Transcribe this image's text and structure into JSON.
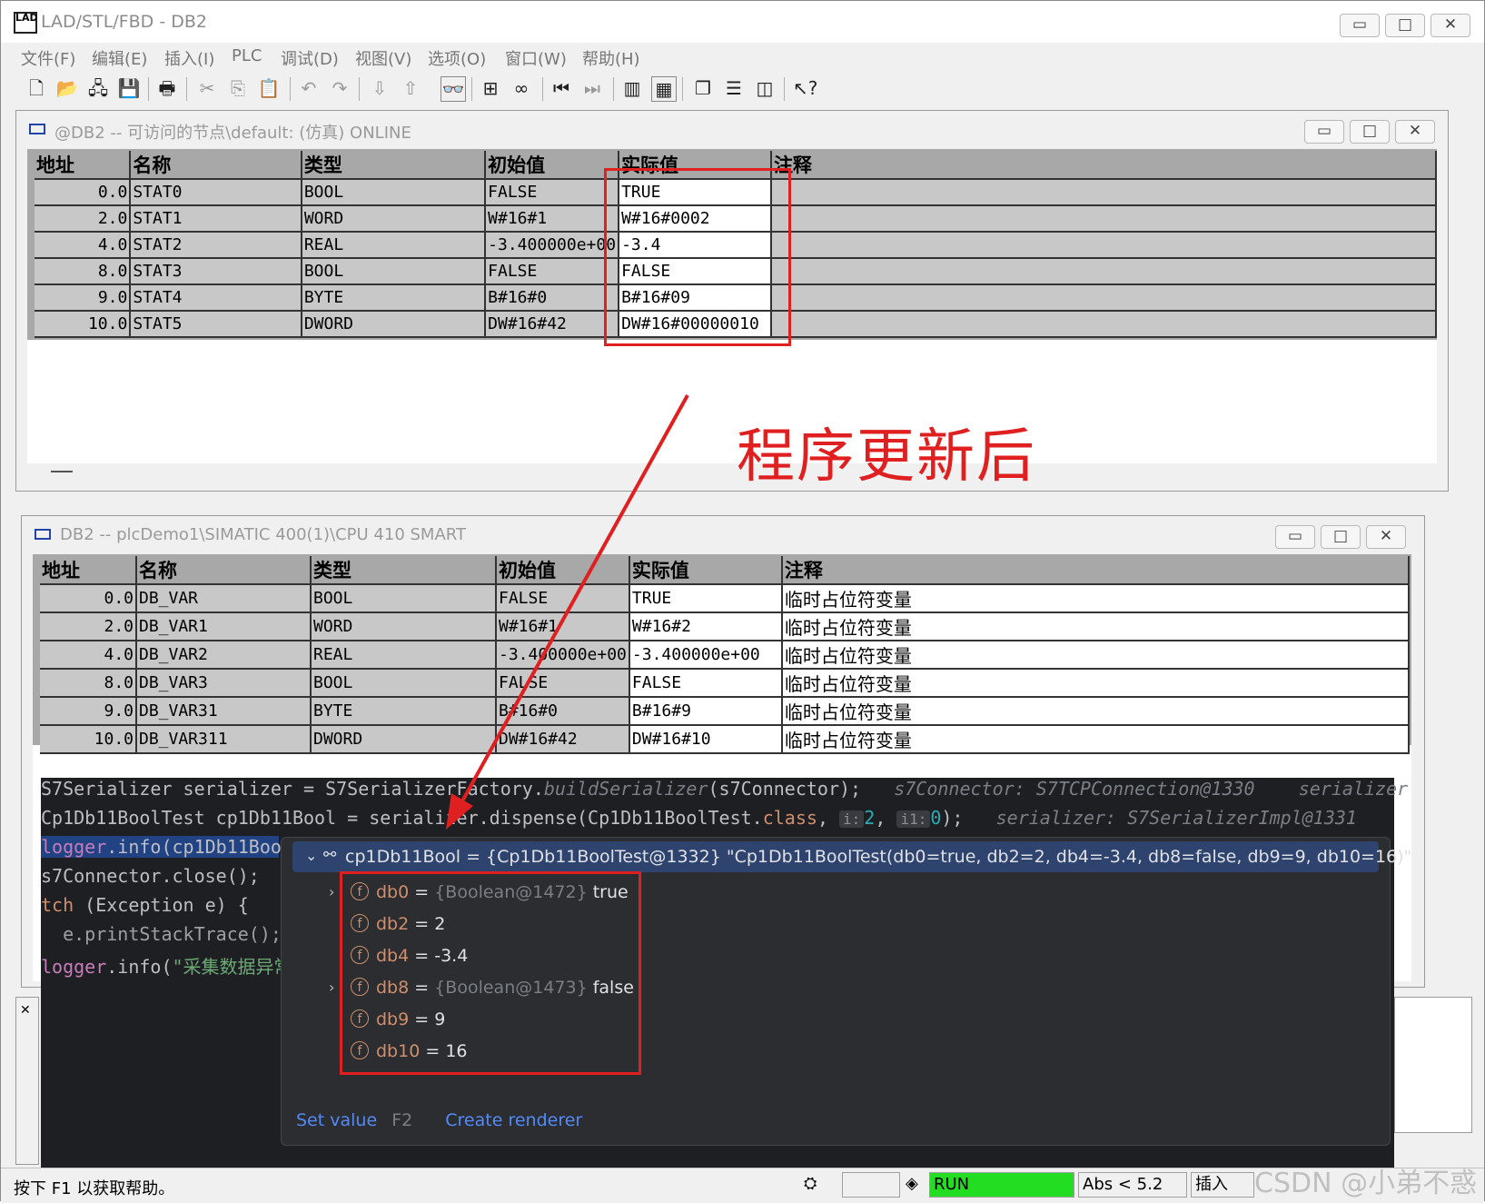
{
  "window": {
    "title": "LAD/STL/FBD  - DB2",
    "app_icon_text": "LAD"
  },
  "menu": [
    "文件(F)",
    "编辑(E)",
    "插入(I)",
    "PLC",
    "调试(D)",
    "视图(V)",
    "选项(O)",
    "窗口(W)",
    "帮助(H)"
  ],
  "online_window": {
    "title": "@DB2 -- 可访问的节点\\default:  (仿真)  ONLINE",
    "columns": [
      "地址",
      "名称",
      "类型",
      "初始值",
      "实际值",
      "注释"
    ],
    "rows": [
      {
        "addr": "0.0",
        "name": "STAT0",
        "type": "BOOL",
        "init": "FALSE",
        "actual": "TRUE",
        "comment": ""
      },
      {
        "addr": "2.0",
        "name": "STAT1",
        "type": "WORD",
        "init": "W#16#1",
        "actual": "W#16#0002",
        "comment": ""
      },
      {
        "addr": "4.0",
        "name": "STAT2",
        "type": "REAL",
        "init": "-3.400000e+00",
        "actual": "-3.4",
        "comment": ""
      },
      {
        "addr": "8.0",
        "name": "STAT3",
        "type": "BOOL",
        "init": "FALSE",
        "actual": "FALSE",
        "comment": ""
      },
      {
        "addr": "9.0",
        "name": "STAT4",
        "type": "BYTE",
        "init": "B#16#0",
        "actual": "B#16#09",
        "comment": ""
      },
      {
        "addr": "10.0",
        "name": "STAT5",
        "type": "DWORD",
        "init": "DW#16#42",
        "actual": "DW#16#00000010",
        "comment": ""
      }
    ]
  },
  "offline_window": {
    "title": "DB2 -- plcDemo1\\SIMATIC 400(1)\\CPU 410 SMART",
    "columns": [
      "地址",
      "名称",
      "类型",
      "初始值",
      "实际值",
      "注释"
    ],
    "rows": [
      {
        "addr": "0.0",
        "name": "DB_VAR",
        "type": "BOOL",
        "init": "FALSE",
        "actual": "TRUE",
        "comment": "临时占位符变量"
      },
      {
        "addr": "2.0",
        "name": "DB_VAR1",
        "type": "WORD",
        "init": "W#16#1",
        "actual": "W#16#2",
        "comment": "临时占位符变量"
      },
      {
        "addr": "4.0",
        "name": "DB_VAR2",
        "type": "REAL",
        "init": "-3.400000e+00",
        "actual": "-3.400000e+00",
        "comment": "临时占位符变量"
      },
      {
        "addr": "8.0",
        "name": "DB_VAR3",
        "type": "BOOL",
        "init": "FALSE",
        "actual": "FALSE",
        "comment": "临时占位符变量"
      },
      {
        "addr": "9.0",
        "name": "DB_VAR31",
        "type": "BYTE",
        "init": "B#16#0",
        "actual": "B#16#9",
        "comment": "临时占位符变量"
      },
      {
        "addr": "10.0",
        "name": "DB_VAR311",
        "type": "DWORD",
        "init": "DW#16#42",
        "actual": "DW#16#10",
        "comment": "临时占位符变量"
      }
    ]
  },
  "annotation": "程序更新后",
  "code": {
    "line1_a": "S7Serializer serializer = S7SerializerFactory.",
    "line1_b": "buildSerializer",
    "line1_c": "(s7Connector);",
    "line1_hint": "s7Connector: S7TCPConnection@1330    serializer",
    "line2_a": "Cp1Db11BoolTest cp1Db11Bool = serializer.dispense(Cp1Db11BoolTest.",
    "line2_kw": "class",
    "line2_h1": "i:",
    "line2_n1": "2",
    "line2_h2": "i1:",
    "line2_n2": "0",
    "line2_end": ");",
    "line2_hint": "serializer: S7SerializerImpl@1331",
    "line3_fld": "logger",
    "line3_rest": ".info(cp1Db11Boo",
    "line4": "s7Connector.close();",
    "line5_kw": "tch",
    "line5_rest": " (Exception e) {",
    "line6": "  e.printStackTrace();",
    "line7_fld": "logger",
    "line7_rest": ".info(",
    "line7_str": "\"采集数据异常"
  },
  "debug_popup": {
    "header": "cp1Db11Bool = {Cp1Db11BoolTest@1332} \"Cp1Db11BoolTest(db0=true, db2=2, db4=-3.4, db8=false, db9=9, db10=16)\"",
    "fields": [
      {
        "name": "db0",
        "eq": " = ",
        "ref": "{Boolean@1472}",
        "value": " true",
        "expandable": true
      },
      {
        "name": "db2",
        "eq": " = ",
        "ref": "",
        "value": "2",
        "expandable": false
      },
      {
        "name": "db4",
        "eq": " = ",
        "ref": "",
        "value": "-3.4",
        "expandable": false
      },
      {
        "name": "db8",
        "eq": " = ",
        "ref": "{Boolean@1473}",
        "value": " false",
        "expandable": true
      },
      {
        "name": "db9",
        "eq": " = ",
        "ref": "",
        "value": "9",
        "expandable": false
      },
      {
        "name": "db10",
        "eq": " = ",
        "ref": "",
        "value": "16",
        "expandable": false
      }
    ],
    "set_value": "Set value",
    "set_value_key": "F2",
    "create_renderer": "Create renderer"
  },
  "statusbar": {
    "help": "按下 F1 以获取帮助。",
    "run": "RUN",
    "abs": "Abs < 5.2",
    "insert": "插入"
  },
  "watermark": "CSDN @小弟不惑",
  "colors": {
    "annotation_red": "#e02020",
    "run_green": "#22dd22",
    "ide_bg": "#1e1f22"
  }
}
